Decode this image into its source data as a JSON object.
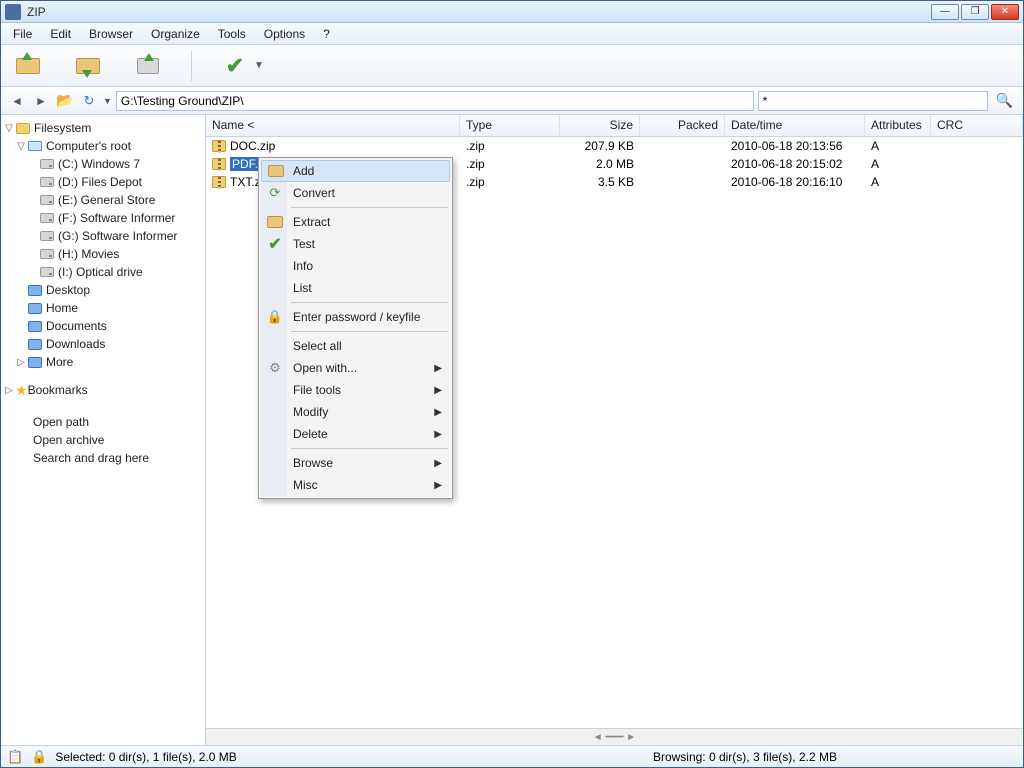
{
  "title": "ZIP",
  "menu": [
    "File",
    "Edit",
    "Browser",
    "Organize",
    "Tools",
    "Options",
    "?"
  ],
  "path": "G:\\Testing Ground\\ZIP\\",
  "filter": "*",
  "tree": {
    "filesystem": "Filesystem",
    "root": "Computer's root",
    "drives": [
      "(C:) Windows 7",
      "(D:) Files Depot",
      "(E:) General Store",
      "(F:) Software Informer",
      "(G:) Software Informer",
      "(H:) Movies",
      "(I:) Optical drive"
    ],
    "places": [
      "Desktop",
      "Home",
      "Documents",
      "Downloads"
    ],
    "more": "More",
    "bookmarks": "Bookmarks",
    "actions": [
      "Open path",
      "Open archive",
      "Search and drag here"
    ]
  },
  "columns": [
    "Name <",
    "Type",
    "Size",
    "Packed",
    "Date/time",
    "Attributes",
    "CRC"
  ],
  "files": [
    {
      "name": "DOC.zip",
      "type": ".zip",
      "size": "207.9 KB",
      "packed": "",
      "date": "2010-06-18 20:13:56",
      "attr": "A"
    },
    {
      "name": "PDF.zip",
      "name_trunc": "PDF.z",
      "type": ".zip",
      "size": "2.0 MB",
      "packed": "",
      "date": "2010-06-18 20:15:02",
      "attr": "A",
      "selected": true
    },
    {
      "name": "TXT.zip",
      "name_trunc": "TXT.z",
      "type": ".zip",
      "size": "3.5 KB",
      "packed": "",
      "date": "2010-06-18 20:16:10",
      "attr": "A"
    }
  ],
  "ctx": [
    "Add",
    "Convert",
    "Extract",
    "Test",
    "Info",
    "List",
    "Enter password / keyfile",
    "Select all",
    "Open with...",
    "File tools",
    "Modify",
    "Delete",
    "Browse",
    "Misc"
  ],
  "status": {
    "selected": "Selected: 0 dir(s), 1 file(s), 2.0 MB",
    "browsing": "Browsing: 0 dir(s), 3 file(s), 2.2 MB"
  }
}
